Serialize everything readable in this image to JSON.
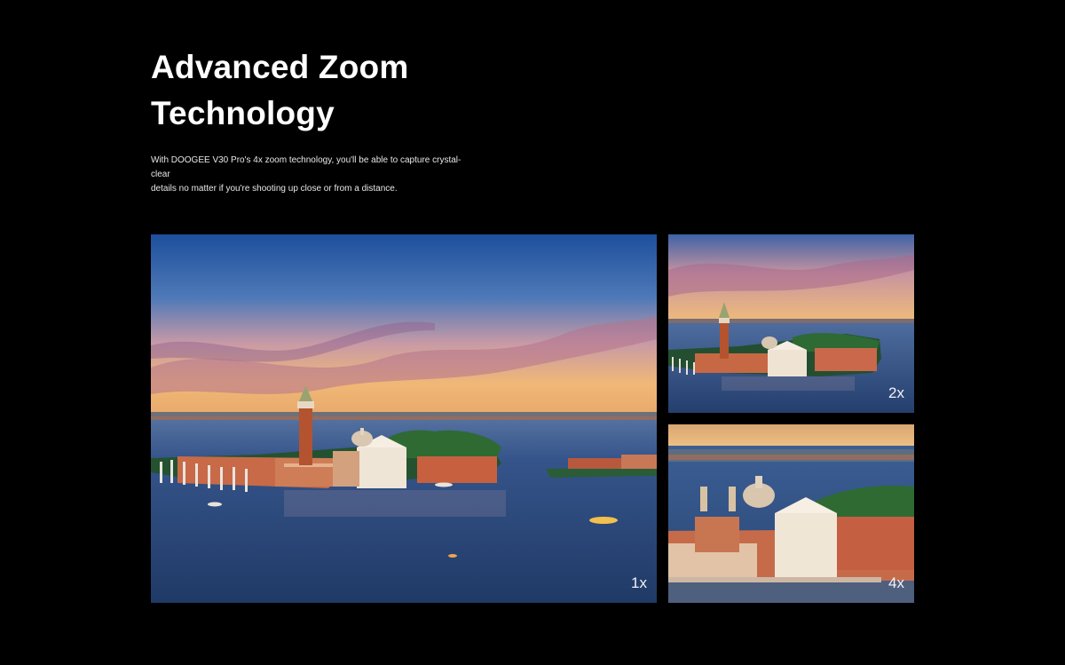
{
  "hero": {
    "title_line_1": "Advanced Zoom",
    "title_line_2": "Technology",
    "description_line_1": "With DOOGEE V30 Pro's 4x zoom technology, you'll be able to capture crystal-clear",
    "description_line_2": "details no matter if you're shooting up close or from a distance."
  },
  "gallery": {
    "photo_1x": {
      "label": "1x"
    },
    "photo_2x": {
      "label": "2x"
    },
    "photo_4x": {
      "label": "4x"
    }
  },
  "colors": {
    "background": "#000000",
    "text": "#ffffff",
    "sky_top": "#1f4f98",
    "sunset": "#f1b56c",
    "water": "#2d4a78",
    "brick": "#b9583a"
  }
}
